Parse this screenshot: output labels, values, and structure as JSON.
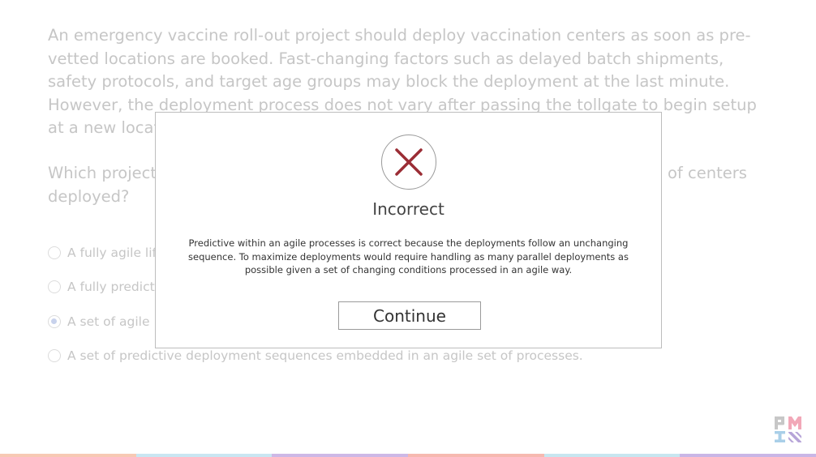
{
  "question": {
    "text": "An emergency vaccine roll-out project should deploy vaccination centers as soon as pre-vetted locations are booked. Fast-changing factors such as delayed batch shipments, safety protocols, and target age groups may block the deployment at the last minute. However, the deployment process does not vary after passing the tollgate to begin setup at a new location.",
    "prompt_left": "Which project",
    "prompt_right": "of centers",
    "prompt_line2": "deployed?"
  },
  "options": [
    {
      "label": "A fully agile lif",
      "checked": false
    },
    {
      "label": "A fully predict",
      "checked": false
    },
    {
      "label": "A set of agile",
      "checked": true
    },
    {
      "label": "A set of predictive deployment sequences embedded in an agile set of processes.",
      "checked": false
    }
  ],
  "modal": {
    "icon": "close-x-icon",
    "title": "Incorrect",
    "feedback": "Predictive within an agile processes is correct because the deployments follow an unchanging sequence. To maximize deployments would require handling as many parallel deployments as possible given a set of changing conditions processed in an agile way.",
    "continue_label": "Continue"
  },
  "colors": {
    "x_mark": "#9b2d35",
    "logo_pink": "#f2a8b8",
    "logo_blue": "#a9cfe8",
    "logo_purple": "#b6a4d8",
    "strip": [
      "#f7c9b4",
      "#c9e6f2",
      "#cdb8e6",
      "#f6b9b0",
      "#c7e6f0",
      "#c9b6e6"
    ]
  }
}
